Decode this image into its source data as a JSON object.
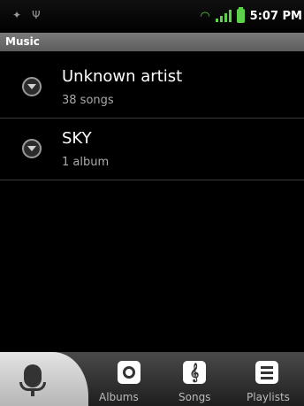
{
  "status": {
    "time": "5:07 PM",
    "icons": [
      "android-icon",
      "usb-icon",
      "wifi-icon",
      "signal-icon",
      "battery-icon"
    ],
    "battery_color": "#5ed14a"
  },
  "app": {
    "title": "Music"
  },
  "list": {
    "items": [
      {
        "title": "Unknown artist",
        "subtitle": "38 songs"
      },
      {
        "title": "SKY",
        "subtitle": "1 album"
      }
    ]
  },
  "tabs": [
    {
      "label": "",
      "icon": "microphone-icon",
      "selected": true
    },
    {
      "label": "Albums",
      "icon": "album-disc-icon"
    },
    {
      "label": "Songs",
      "icon": "treble-clef-icon"
    },
    {
      "label": "Playlists",
      "icon": "playlist-icon"
    }
  ]
}
